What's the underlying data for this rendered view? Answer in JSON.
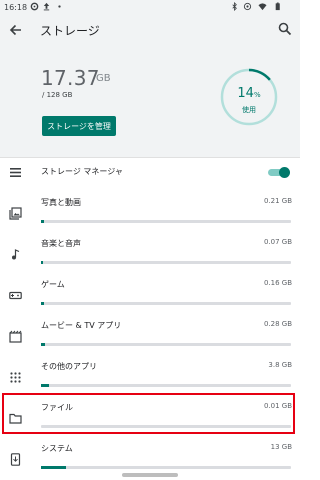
{
  "status_bar": {
    "time": "16:18",
    "icons": [
      "gear-icon",
      "upload-icon",
      "dot-icon",
      "bluetooth-icon",
      "rotate-icon",
      "wifi-icon",
      "battery-icon"
    ]
  },
  "app_bar": {
    "title": "ストレージ",
    "back_icon": "back-arrow-icon",
    "search_icon": "search-icon"
  },
  "summary": {
    "used_value": "17.37",
    "used_unit": "GB",
    "total": "/ 128 GB",
    "percent": "14",
    "percent_sign": "%",
    "percent_label": "使用",
    "percent_fraction": 0.14,
    "manage_button": "ストレージを管理"
  },
  "storage_manager": {
    "label": "ストレージ マネージャ",
    "enabled": true
  },
  "categories": [
    {
      "label": "写真と動画",
      "size": "0.21 GB",
      "fill": 0.01,
      "icon": "photo-icon"
    },
    {
      "label": "音楽と音声",
      "size": "0.07 GB",
      "fill": 0.004,
      "icon": "music-note-icon"
    },
    {
      "label": "ゲーム",
      "size": "0.16 GB",
      "fill": 0.01,
      "icon": "gamepad-icon"
    },
    {
      "label": "ムービー & TV アプリ",
      "size": "0.28 GB",
      "fill": 0.015,
      "icon": "movie-icon"
    },
    {
      "label": "その他のアプリ",
      "size": "3.8 GB",
      "fill": 0.03,
      "icon": "apps-grid-icon"
    },
    {
      "label": "ファイル",
      "size": "0.01 GB",
      "fill": 0.0,
      "icon": "folder-icon"
    },
    {
      "label": "システム",
      "size": "13 GB",
      "fill": 0.1,
      "icon": "system-update-icon"
    }
  ],
  "colors": {
    "accent": "#00796b",
    "accent_light": "#80cbc4",
    "highlight": "#e60012",
    "track": "#dadce0"
  }
}
